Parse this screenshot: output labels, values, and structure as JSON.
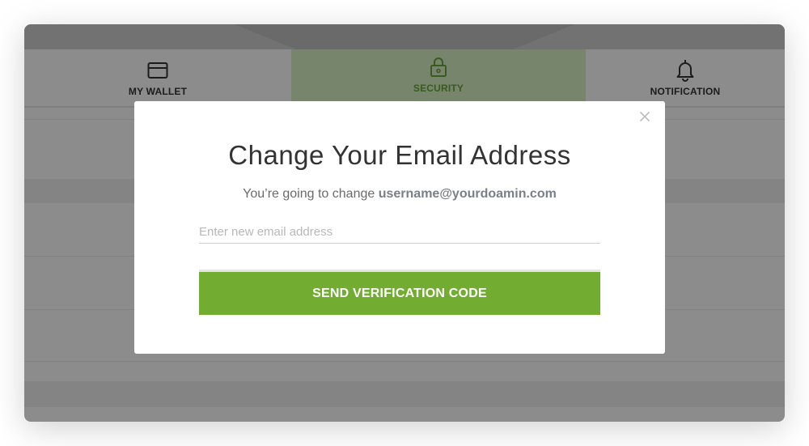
{
  "tabs": [
    {
      "label": "MY WALLET",
      "icon": "card-icon"
    },
    {
      "label": "SECURITY",
      "icon": "lock-icon",
      "active": true
    },
    {
      "label": "NOTIFICATION",
      "icon": "bell-icon"
    }
  ],
  "modal": {
    "title": "Change Your Email Address",
    "subtitle_prefix": "You’re going to change",
    "current_email": "username@yourdoamin.com",
    "email_input": {
      "placeholder": "Enter new email address",
      "value": ""
    },
    "send_button_label": "SEND VERIFICATION CODE",
    "close_icon": "close-icon"
  },
  "colors": {
    "accent": "#72ad32",
    "active_tab_bg": "#d9f2c5",
    "active_tab_text": "#6aa43a",
    "overlay": "rgba(0,0,0,0.45)"
  }
}
